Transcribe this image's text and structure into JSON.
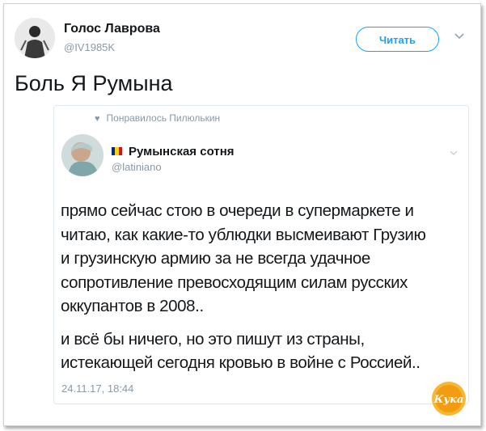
{
  "header": {
    "name": "Голос Лаврова",
    "handle": "@IV1985K",
    "follow_label": "Читать"
  },
  "tweet": {
    "text": "Боль Я Румына"
  },
  "quoted": {
    "liked_by": "Понравилось Пилюлькин",
    "name": "Румынская сотня",
    "handle": "@latiniano",
    "flag_colors": [
      "#002b7f",
      "#fcd116",
      "#ce1126"
    ],
    "lines_p1": [
      "прямо сейчас стою в очереди в супермаркете и",
      "читаю, как какие-то ублюдки высмеивают Грузию",
      "и грузинскую армию за не всегда удачное",
      "сопротивление превосходящим силам русских",
      "оккупантов в 2008.."
    ],
    "lines_p2": [
      "и всё бы ничего, но это пишут из страны,",
      "истекающей сегодня кровью в войне с Россией.."
    ],
    "date": "24.11.17, 18:44"
  },
  "watermark": {
    "text": "Кука",
    "color": "#f5a623"
  },
  "icons": [
    "avatar",
    "chevron-down-icon",
    "heart-icon",
    "flag-icon",
    "watermark-logo"
  ]
}
